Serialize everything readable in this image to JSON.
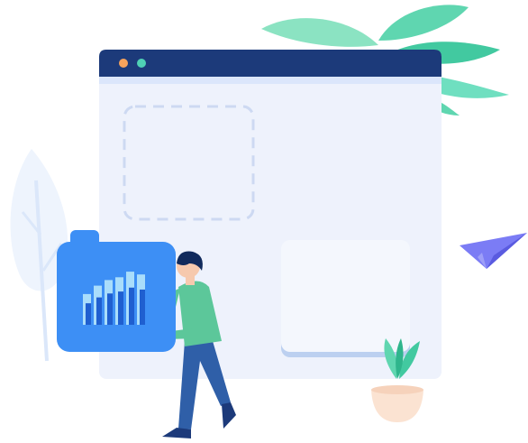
{
  "illustration": {
    "subject": "empty-state",
    "colors": {
      "window_bar": "#1c3a7a",
      "window_bg": "#eef2fc",
      "dot_orange": "#f7a35c",
      "dot_teal": "#4fd1b5",
      "folder_blue": "#3d8ff5",
      "leaf_green": "#5fd6b0",
      "plane_purple": "#7b7cf5",
      "person_shirt": "#5cc79a",
      "person_pants": "#2f5fa8",
      "pot": "#fbe3d2"
    },
    "bar_chart_values": [
      0.55,
      0.7,
      0.8,
      0.85,
      0.95,
      0.9
    ]
  }
}
